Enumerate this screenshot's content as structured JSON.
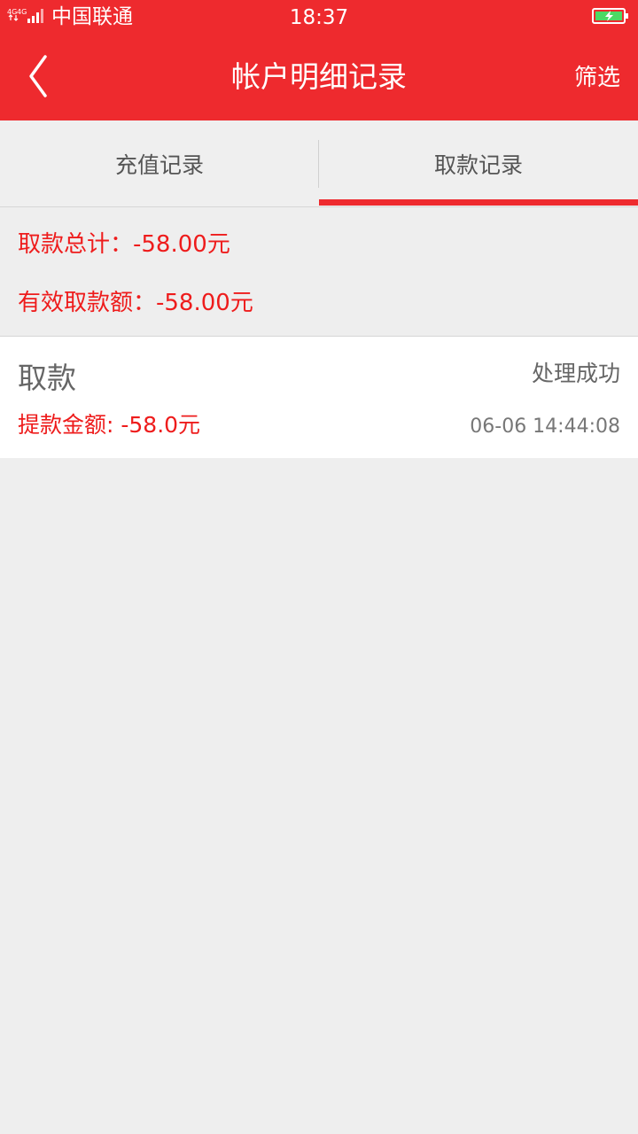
{
  "status_bar": {
    "network": "4G 4G",
    "carrier": "中国联通",
    "time": "18:37"
  },
  "nav": {
    "title": "帐户明细记录",
    "filter_label": "筛选"
  },
  "tabs": [
    {
      "label": "充值记录",
      "active": false
    },
    {
      "label": "取款记录",
      "active": true
    }
  ],
  "summary": {
    "total_label": "取款总计：-58.00元",
    "valid_label": "有效取款额：-58.00元"
  },
  "records": [
    {
      "title": "取款",
      "status": "处理成功",
      "amount": "提款金额: -58.0元",
      "datetime": "06-06  14:44:08"
    }
  ],
  "colors": {
    "accent": "#ee2a2e",
    "amount_red": "#ee1c1c",
    "background": "#eeeeee"
  },
  "icons": {
    "back": "chevron-left-icon",
    "signal": "signal-icon",
    "battery": "battery-charging-icon"
  }
}
